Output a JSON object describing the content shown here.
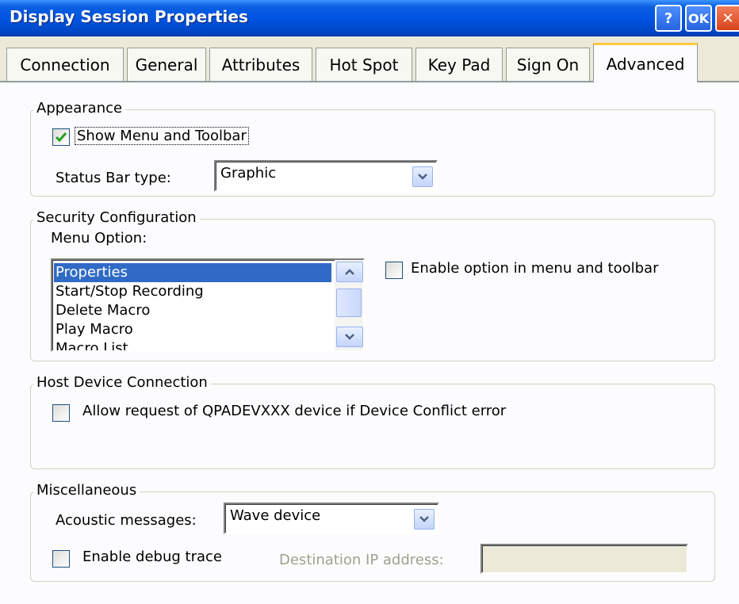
{
  "window": {
    "title": "Display Session Properties",
    "help_label": "?",
    "ok_label": "OK",
    "close_label": "✕"
  },
  "tabs": [
    {
      "label": "Connection"
    },
    {
      "label": "General"
    },
    {
      "label": "Attributes"
    },
    {
      "label": "Hot Spot"
    },
    {
      "label": "Key Pad"
    },
    {
      "label": "Sign On"
    },
    {
      "label": "Advanced",
      "active": true
    }
  ],
  "appearance": {
    "legend": "Appearance",
    "show_menu_label": "Show Menu and Toolbar",
    "show_menu_checked": true,
    "status_bar_label": "Status Bar type:",
    "status_bar_value": "Graphic"
  },
  "security": {
    "legend": "Security Configuration",
    "menu_option_label": "Menu Option:",
    "menu_options": [
      "Properties",
      "Start/Stop Recording",
      "Delete Macro",
      "Play Macro",
      "Macro List"
    ],
    "selected_index": 0,
    "enable_option_label": "Enable option in menu and toolbar",
    "enable_option_checked": false
  },
  "host": {
    "legend": "Host Device Connection",
    "allow_request_label": "Allow request of QPADEVXXX device if Device Conflict error",
    "allow_request_checked": false
  },
  "misc": {
    "legend": "Miscellaneous",
    "acoustic_label": "Acoustic messages:",
    "acoustic_value": "Wave device",
    "debug_label": "Enable debug trace",
    "debug_checked": false,
    "dest_ip_label": "Destination IP address:",
    "dest_ip_value": ""
  },
  "colors": {
    "title_bar": "#0054E3",
    "selection": "#316AC5",
    "checkmark": "#21A121",
    "tab_highlight": "#FFC83D"
  }
}
